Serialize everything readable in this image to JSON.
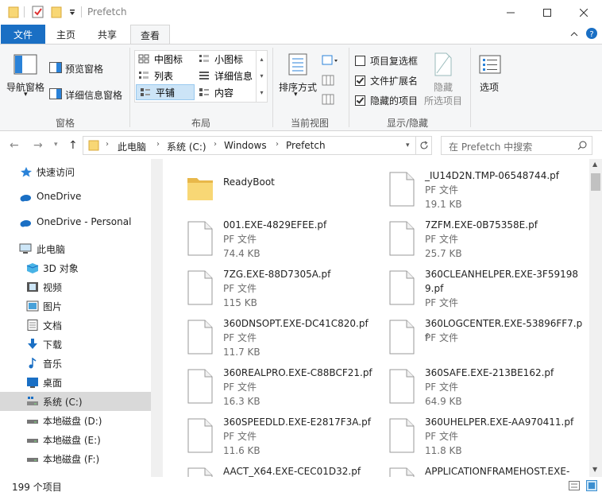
{
  "window": {
    "title": "Prefetch"
  },
  "ribbon_tabs": [
    "文件",
    "主页",
    "共享",
    "查看"
  ],
  "ribbon": {
    "panes": {
      "nav_pane": "导航窗格",
      "preview_pane": "预览窗格",
      "details_pane": "详细信息窗格",
      "label": "窗格"
    },
    "layout": {
      "items": [
        "中图标",
        "小图标",
        "列表",
        "详细信息",
        "平铺",
        "内容"
      ],
      "selected": "平铺",
      "label": "布局"
    },
    "current_view": {
      "sort_by": "排序方式",
      "label": "当前视图"
    },
    "show_hide": {
      "item_checkboxes": "项目复选框",
      "file_extensions": "文件扩展名",
      "hidden_items": "隐藏的项目",
      "hide_selected_1": "隐藏",
      "hide_selected_2": "所选项目",
      "label": "显示/隐藏",
      "checked": {
        "item_checkboxes": false,
        "file_extensions": true,
        "hidden_items": true
      }
    },
    "options": "选项"
  },
  "address": {
    "crumbs": [
      "此电脑",
      "系统 (C:)",
      "Windows",
      "Prefetch"
    ]
  },
  "search": {
    "placeholder": "在 Prefetch 中搜索"
  },
  "sidebar": {
    "items": [
      {
        "label": "快速访问"
      },
      {
        "label": "OneDrive"
      },
      {
        "label": "OneDrive - Personal"
      },
      {
        "label": "此电脑"
      },
      {
        "label": "3D 对象"
      },
      {
        "label": "视频"
      },
      {
        "label": "图片"
      },
      {
        "label": "文档"
      },
      {
        "label": "下载"
      },
      {
        "label": "音乐"
      },
      {
        "label": "桌面"
      },
      {
        "label": "系统 (C:)"
      },
      {
        "label": "本地磁盘 (D:)"
      },
      {
        "label": "本地磁盘 (E:)"
      },
      {
        "label": "本地磁盘 (F:)"
      }
    ]
  },
  "files": [
    {
      "name": "ReadyBoot",
      "type": "",
      "size": "",
      "folder": true
    },
    {
      "name": "_IU14D2N.TMP-06548744.pf",
      "type": "PF 文件",
      "size": "19.1 KB"
    },
    {
      "name": "001.EXE-4829EFEE.pf",
      "type": "PF 文件",
      "size": "74.4 KB"
    },
    {
      "name": "7ZFM.EXE-0B75358E.pf",
      "type": "PF 文件",
      "size": "25.7 KB"
    },
    {
      "name": "7ZG.EXE-88D7305A.pf",
      "type": "PF 文件",
      "size": "115 KB"
    },
    {
      "name": "360CLEANHELPER.EXE-3F591989.pf",
      "type": "PF 文件",
      "size": ""
    },
    {
      "name": "360DNSOPT.EXE-DC41C820.pf",
      "type": "PF 文件",
      "size": "11.7 KB"
    },
    {
      "name": "360LOGCENTER.EXE-53896FF7.pf",
      "type": "PF 文件",
      "size": ""
    },
    {
      "name": "360REALPRO.EXE-C88BCF21.pf",
      "type": "PF 文件",
      "size": "16.3 KB"
    },
    {
      "name": "360SAFE.EXE-213BE162.pf",
      "type": "PF 文件",
      "size": "64.9 KB"
    },
    {
      "name": "360SPEEDLD.EXE-E2817F3A.pf",
      "type": "PF 文件",
      "size": "11.6 KB"
    },
    {
      "name": "360UHELPER.EXE-AA970411.pf",
      "type": "PF 文件",
      "size": "11.8 KB"
    },
    {
      "name": "AACT_X64.EXE-CEC01D32.pf",
      "type": "",
      "size": ""
    },
    {
      "name": "APPLICATIONFRAMEHOST.EXE-",
      "type": "",
      "size": ""
    }
  ],
  "status": {
    "count": "199 个项目"
  }
}
